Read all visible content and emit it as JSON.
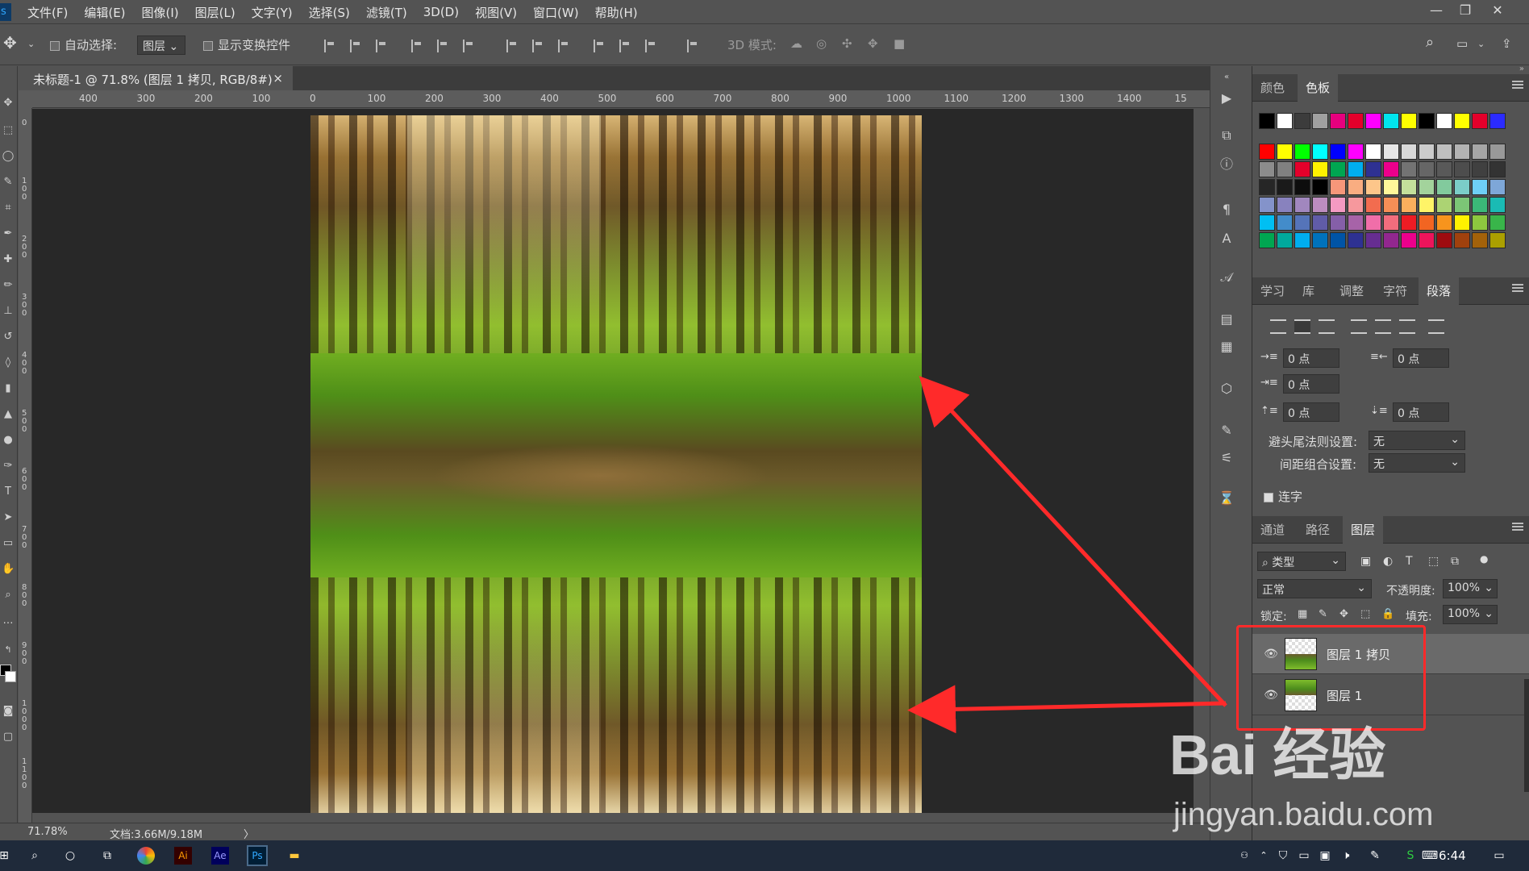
{
  "menubar": {
    "items": [
      "文件(F)",
      "编辑(E)",
      "图像(I)",
      "图层(L)",
      "文字(Y)",
      "选择(S)",
      "滤镜(T)",
      "3D(D)",
      "视图(V)",
      "窗口(W)",
      "帮助(H)"
    ]
  },
  "options_bar": {
    "auto_select_label": "自动选择:",
    "auto_select_value": "图层",
    "show_transform_label": "显示变换控件",
    "mode_3d_label": "3D 模式:"
  },
  "document": {
    "tab_title": "未标题-1 @ 71.8% (图层 1 拷贝, RGB/8#) *",
    "close_glyph": "×"
  },
  "ruler": {
    "h_ticks": [
      "400",
      "300",
      "200",
      "100",
      "0",
      "100",
      "200",
      "300",
      "400",
      "500",
      "600",
      "700",
      "800",
      "900",
      "1000",
      "1100",
      "1200",
      "1300",
      "1400",
      "15"
    ],
    "v_ticks": [
      "0",
      "1 0 0",
      "2 0 0",
      "3 0 0",
      "4 0 0",
      "5 0 0",
      "6 0 0",
      "7 0 0",
      "8 0 0",
      "9 0 0",
      "1 0 0 0",
      "1 1 0 0"
    ]
  },
  "status": {
    "zoom": "71.78%",
    "doc_info": "文档:3.66M/9.18M",
    "arrow": "〉"
  },
  "swatches_panel": {
    "tabs": [
      "颜色",
      "色板"
    ],
    "active_tab": "色板",
    "colors_row1": [
      "#000000",
      "#ffffff",
      "#3c3c3c",
      "#a0a0a0",
      "#e6007e",
      "#e4002b",
      "#ff00ff",
      "#00e5ee",
      "#ffff00",
      "#000000",
      "#ffffff",
      "#ffff00",
      "#e4002b",
      "#2b2bff"
    ],
    "colors_grid": [
      [
        "#ff0000",
        "#ffff00",
        "#00ff00",
        "#00ffff",
        "#0000ff",
        "#ff00ff",
        "#ffffff",
        "#e6e6e6",
        "#d9d9d9",
        "#cccccc",
        "#bfbfbf",
        "#b3b3b3",
        "#a6a6a6",
        "#999999"
      ],
      [
        "#8c8c8c",
        "#808080",
        "#e4002b",
        "#fff200",
        "#00a651",
        "#00aeef",
        "#2e3192",
        "#ec008c",
        "#737373",
        "#666666",
        "#595959",
        "#4d4d4d",
        "#404040",
        "#333333"
      ],
      [
        "#262626",
        "#1a1a1a",
        "#0d0d0d",
        "#000000",
        "#f7977a",
        "#f9ad81",
        "#fdc68a",
        "#fff79a",
        "#c4df9b",
        "#a3d39c",
        "#82ca9d",
        "#7bcdc8",
        "#6ecff6",
        "#7ea7d8"
      ],
      [
        "#8493ca",
        "#8882be",
        "#a187be",
        "#bc8dbf",
        "#f49ac2",
        "#f6989d",
        "#f26c4f",
        "#f68e56",
        "#fbaf5d",
        "#fff467",
        "#acd373",
        "#7cc576",
        "#3bb878",
        "#1abbb4"
      ],
      [
        "#00bff3",
        "#438cca",
        "#5574b9",
        "#605ca8",
        "#855fa8",
        "#a763a8",
        "#f06ea9",
        "#f26d7d",
        "#ed1c24",
        "#f26522",
        "#f7941d",
        "#fff200",
        "#8dc73f",
        "#39b54a"
      ],
      [
        "#00a651",
        "#00a99d",
        "#00aeef",
        "#0072bc",
        "#0054a6",
        "#2e3192",
        "#662d91",
        "#92278f",
        "#ec008c",
        "#ed145b",
        "#9e0b0f",
        "#a0410d",
        "#a3620a",
        "#aba000"
      ]
    ]
  },
  "paragraph_panel": {
    "tabs": [
      "学习",
      "库",
      "调整",
      "字符",
      "段落"
    ],
    "active_tab": "段落",
    "indent_left": "0 点",
    "indent_right": "0 点",
    "indent_first": "0 点",
    "space_before": "0 点",
    "space_after": "0 点",
    "kinsoku_label": "避头尾法则设置:",
    "kinsoku_value": "无",
    "mojikumi_label": "间距组合设置:",
    "mojikumi_value": "无",
    "hyphenate_label": "连字"
  },
  "layers_panel": {
    "tabs": [
      "通道",
      "路径",
      "图层"
    ],
    "active_tab": "图层",
    "filter_kind": "类型",
    "blend_mode": "正常",
    "opacity_label": "不透明度:",
    "opacity_value": "100%",
    "lock_label": "锁定:",
    "fill_label": "填充:",
    "fill_value": "100%",
    "layers": [
      {
        "name": "图层 1 拷贝",
        "selected": true
      },
      {
        "name": "图层 1",
        "selected": false
      }
    ]
  },
  "watermark": {
    "brand": "Bai 经验",
    "url": "jingyan.baidu.com"
  },
  "taskbar": {
    "time": "6:44",
    "app_labels": [
      "Ai",
      "Ae",
      "Ps"
    ]
  },
  "colors": {
    "ui_bg": "#535353",
    "canvas_bg": "#282828",
    "annotation_red": "#ff2a2a",
    "taskbar_bg": "#1f2a3a"
  }
}
